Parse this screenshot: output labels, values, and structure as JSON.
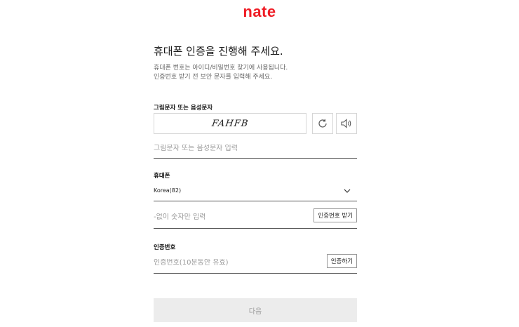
{
  "brand": {
    "logo_text": "nate",
    "logo_color": "#ef1c25"
  },
  "header": {
    "title": "휴대폰 인증을 진행해 주세요.",
    "desc_line1": "휴대폰 번호는 아이디/비밀번호 찾기에 사용됩니다.",
    "desc_line2": "인증번호 받기 전 보안 문자를 입력해 주세요."
  },
  "captcha": {
    "label": "그림문자 또는 음성문자",
    "image_text": "FAHFB",
    "refresh_icon": "refresh-icon",
    "audio_icon": "speaker-icon",
    "input_placeholder": "그림문자 또는 음성문자 입력"
  },
  "phone": {
    "label": "휴대폰",
    "country_value": "Korea(82)",
    "number_placeholder": "-없이 숫자만 입력",
    "request_button": "인증번호 받기"
  },
  "verification": {
    "label": "인증번호",
    "input_placeholder": "인증번호(10분동안 유효)",
    "verify_button": "인증하기"
  },
  "next_button": "다음"
}
